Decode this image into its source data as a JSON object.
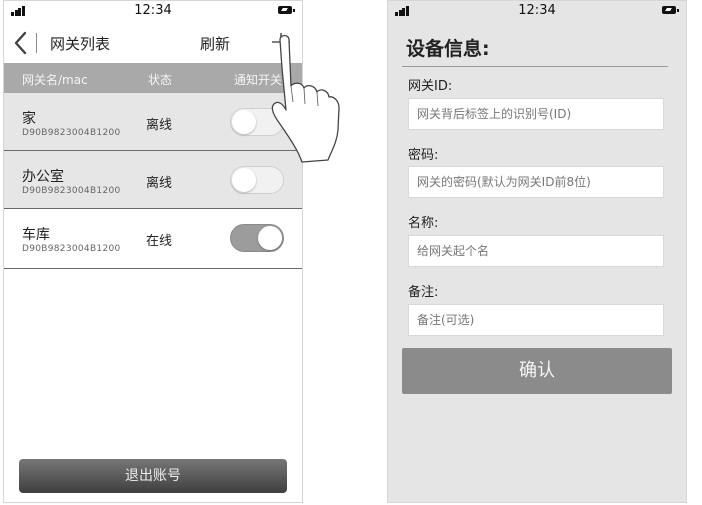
{
  "status_bar": {
    "time": "12:34"
  },
  "gateway_list": {
    "title": "网关列表",
    "refresh_label": "刷新",
    "columns": {
      "name_mac": "网关名/mac",
      "state": "状态",
      "notify": "通知开关"
    },
    "rows": [
      {
        "name": "家",
        "mac": "D90B9823004B1200",
        "state": "离线",
        "notify_on": false
      },
      {
        "name": "办公室",
        "mac": "D90B9823004B1200",
        "state": "离线",
        "notify_on": false
      },
      {
        "name": "车库",
        "mac": "D90B9823004B1200",
        "state": "在线",
        "notify_on": true
      }
    ],
    "logout_label": "退出账号"
  },
  "device_form": {
    "title": "设备信息:",
    "fields": [
      {
        "label": "网关ID:",
        "placeholder": "网关背后标签上的识别号(ID)"
      },
      {
        "label": "密码:",
        "placeholder": "网关的密码(默认为网关ID前8位)"
      },
      {
        "label": "名称:",
        "placeholder": "给网关起个名"
      },
      {
        "label": "备注:",
        "placeholder": "备注(可选)"
      }
    ],
    "confirm_label": "确认"
  },
  "icons": [
    "signal-icon",
    "battery-icon",
    "back-arrow-icon",
    "plus-icon",
    "hand-pointer-icon"
  ]
}
